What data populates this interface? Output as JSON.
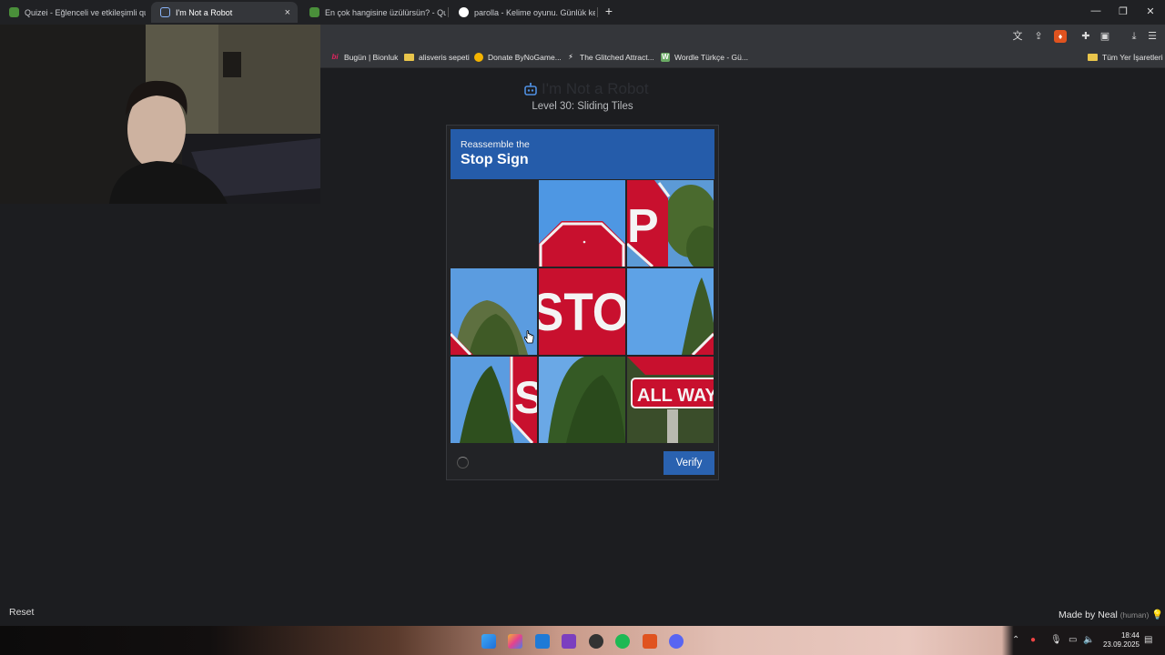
{
  "browser": {
    "tabs": [
      {
        "label": "Quizei - Eğlenceli ve etkileşimli quizle",
        "active": false
      },
      {
        "label": "I'm Not a Robot",
        "active": true
      },
      {
        "label": "En çok hangisine üzülürsün? - Quizei",
        "active": false
      },
      {
        "label": "parolla - Kelime oyunu. Günlük kelime",
        "active": false
      }
    ],
    "new_tab": "+",
    "close_tab": "×",
    "window": {
      "minimize": "—",
      "restore": "❐",
      "close": "✕"
    },
    "bookmarks": [
      {
        "label": "Bugün | Bionluk",
        "icon": "bi",
        "color": "#e0245e"
      },
      {
        "label": "alisveris sepeti",
        "icon": "folder-icon",
        "color": "#e9c54b"
      },
      {
        "label": "Donate ByNoGame...",
        "icon": "bynogame-icon",
        "color": "#f4b400"
      },
      {
        "label": "The Glitched Attract...",
        "icon": "glitch-icon",
        "color": "#ffffff"
      },
      {
        "label": "Wordle Türkçe - Gü...",
        "icon": "W",
        "color": "#6aaa64"
      }
    ],
    "all_bookmarks": "Tüm Yer İşaretleri"
  },
  "page": {
    "title": "I'm Not a Robot",
    "level": "Level 30: Sliding Tiles",
    "instruction": "Reassemble the",
    "target": "Stop Sign",
    "verify_label": "Verify",
    "reset_label": "Reset",
    "credit": "Made by Neal",
    "credit_note": "(human)",
    "tile_texts": [
      "P",
      "STO",
      "S",
      "ALL WAY"
    ]
  },
  "taskbar": {
    "time": "18:44",
    "date": "23.09.2025"
  },
  "colors": {
    "accent": "#2a62b0",
    "header": "#255caa",
    "stop_red": "#c8102e",
    "sky": "#4b90dd"
  }
}
